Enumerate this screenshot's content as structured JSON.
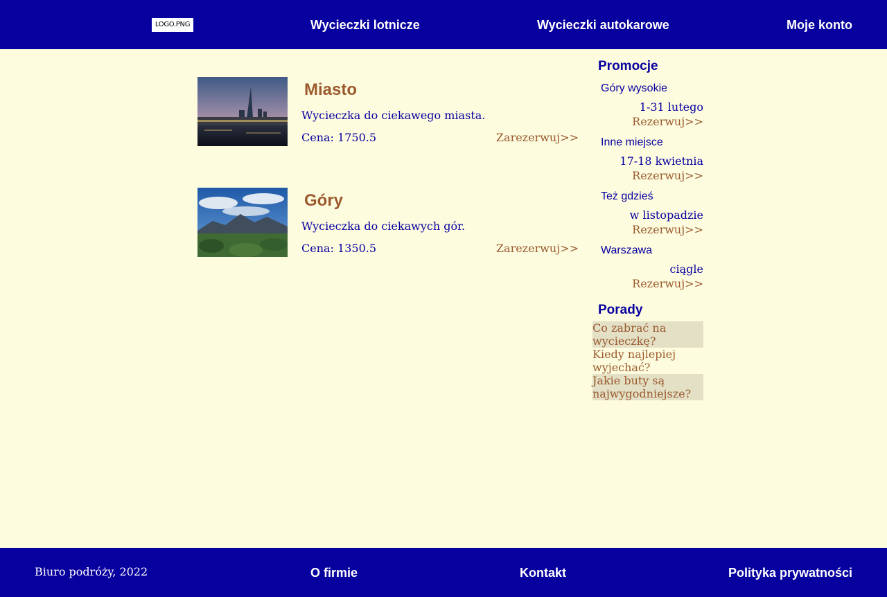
{
  "header": {
    "logo_text": "LOGO.PNG",
    "nav": {
      "flights": "Wycieczki lotnicze",
      "bus": "Wycieczki autokarowe",
      "account": "Moje konto"
    }
  },
  "trips": [
    {
      "title": "Miasto",
      "description": "Wycieczka do ciekawego miasta.",
      "price": "Cena: 1750.5",
      "book_label": "Zarezerwuj>>"
    },
    {
      "title": "Góry",
      "description": "Wycieczka do ciekawych gór.",
      "price": "Cena: 1350.5",
      "book_label": "Zarezerwuj>>"
    }
  ],
  "sidebar": {
    "promo_heading": "Promocje",
    "promos": [
      {
        "name": "Góry wysokie",
        "date": "1-31 lutego",
        "book_label": "Rezerwuj>>"
      },
      {
        "name": "Inne miejsce",
        "date": "17-18 kwietnia",
        "book_label": "Rezerwuj>>"
      },
      {
        "name": "Też gdzieś",
        "date": "w listopadzie",
        "book_label": "Rezerwuj>>"
      },
      {
        "name": "Warszawa",
        "date": "ciągle",
        "book_label": "Rezerwuj>>"
      }
    ],
    "tips_heading": "Porady",
    "tips": [
      "Co zabrać na wycieczkę?",
      "Kiedy najlepiej wyjechać?",
      "Jakie buty są najwygodniejsze?"
    ]
  },
  "footer": {
    "copyright": "Biuro podróży, 2022",
    "about": "O firmie",
    "contact": "Kontakt",
    "privacy": "Polityka prywatności"
  },
  "colors": {
    "navy": "#08009e",
    "background": "#fdfcdf",
    "accent_brown": "#9a5a2e",
    "tip_shade": "#e3e0c6"
  }
}
